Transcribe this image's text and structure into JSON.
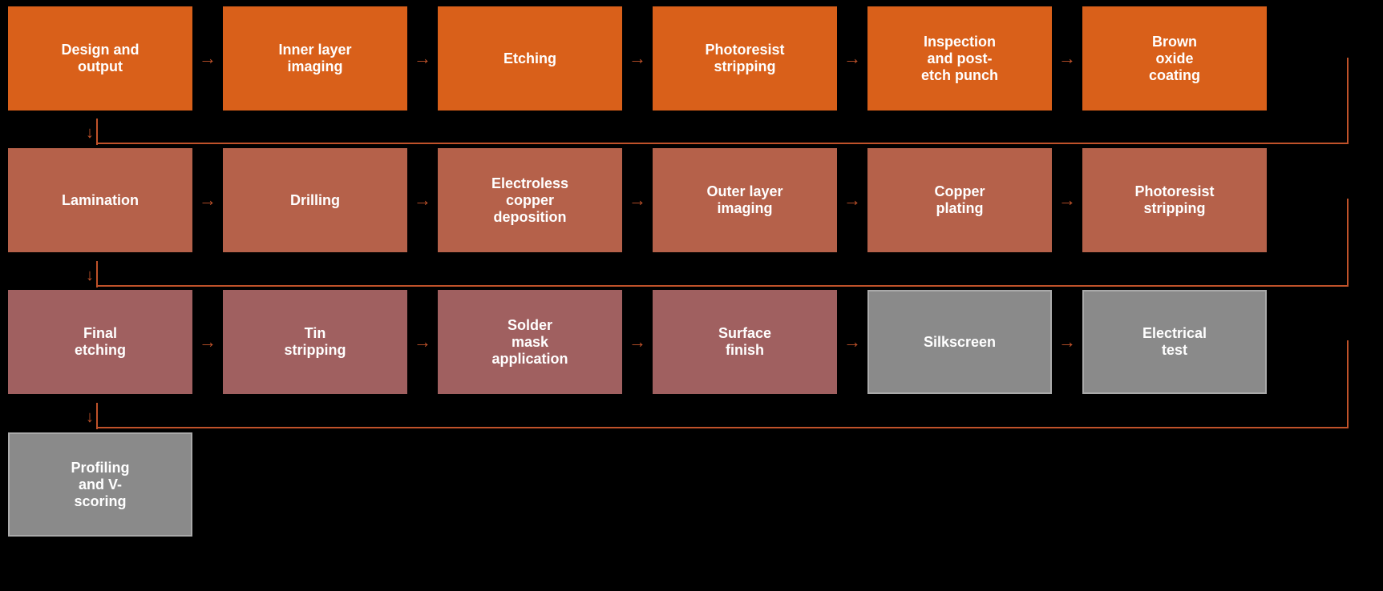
{
  "rows": [
    {
      "id": "row1",
      "boxes": [
        {
          "id": "design-output",
          "label": "Design and\noutput",
          "color": "r1"
        },
        {
          "id": "inner-layer-imaging",
          "label": "Inner layer\nimaging",
          "color": "r1"
        },
        {
          "id": "etching",
          "label": "Etching",
          "color": "r1"
        },
        {
          "id": "photoresist-stripping-1",
          "label": "Photoresist\nstripping",
          "color": "r1"
        },
        {
          "id": "inspection-post-etch",
          "label": "Inspection\nand post-\netch punch",
          "color": "r1"
        },
        {
          "id": "brown-oxide",
          "label": "Brown\noxide\ncoating",
          "color": "r1"
        }
      ]
    },
    {
      "id": "row2",
      "boxes": [
        {
          "id": "lamination",
          "label": "Lamination",
          "color": "r2"
        },
        {
          "id": "drilling",
          "label": "Drilling",
          "color": "r2"
        },
        {
          "id": "electroless-copper",
          "label": "Electroless\ncopper\ndeposition",
          "color": "r2"
        },
        {
          "id": "outer-layer-imaging",
          "label": "Outer layer\nimaging",
          "color": "r2"
        },
        {
          "id": "copper-plating",
          "label": "Copper\nplating",
          "color": "r2"
        },
        {
          "id": "photoresist-stripping-2",
          "label": "Photoresist\nstripping",
          "color": "r2"
        }
      ]
    },
    {
      "id": "row3",
      "boxes": [
        {
          "id": "final-etching",
          "label": "Final\netching",
          "color": "r3"
        },
        {
          "id": "tin-stripping",
          "label": "Tin\nstripping",
          "color": "r3"
        },
        {
          "id": "solder-mask",
          "label": "Solder\nmask\napplication",
          "color": "r3"
        },
        {
          "id": "surface-finish",
          "label": "Surface\nfinish",
          "color": "r3"
        },
        {
          "id": "silkscreen",
          "label": "Silkscreen",
          "color": "r4"
        },
        {
          "id": "electrical-test",
          "label": "Electrical\ntest",
          "color": "r4"
        }
      ]
    },
    {
      "id": "row4",
      "boxes": [
        {
          "id": "profiling-v-scoring",
          "label": "Profiling\nand V-\nscoring",
          "color": "r4"
        }
      ]
    }
  ],
  "arrows": {
    "right": "→",
    "down": "↓"
  }
}
